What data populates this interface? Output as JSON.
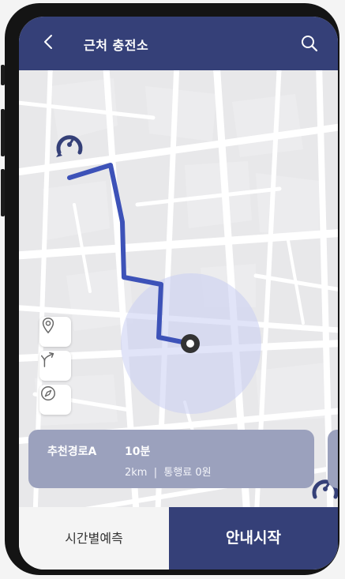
{
  "header": {
    "title": "근처 충전소",
    "back_icon": "chevron-left-icon",
    "search_icon": "search-icon"
  },
  "map": {
    "map_tools": [
      {
        "name": "location-pin-icon"
      },
      {
        "name": "route-fork-icon"
      },
      {
        "name": "compass-icon"
      }
    ],
    "route_color": "#3d52b8",
    "current_location_color": "#333333"
  },
  "route_card": {
    "name": "추천경로A",
    "time": "10분",
    "detail": "2km  |  통행료 0원"
  },
  "bottom": {
    "forecast_label": "시간별예측",
    "start_label": "안내시작"
  },
  "colors": {
    "header_bg": "#354078",
    "card_bg": "#9ba1bd",
    "start_button_bg": "#354078"
  }
}
